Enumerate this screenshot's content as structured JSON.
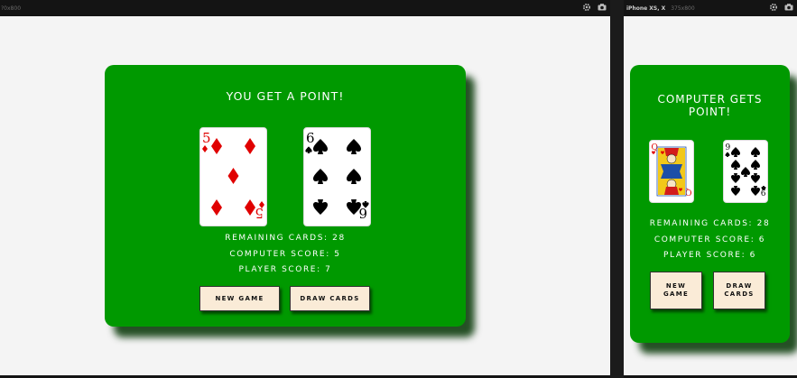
{
  "desktop": {
    "device_label": "?0x800",
    "heading": "YOU GET A POINT!",
    "cards": [
      {
        "rank": "5",
        "suit": "diamonds",
        "color": "#e00000"
      },
      {
        "rank": "6",
        "suit": "spades",
        "color": "#000000"
      }
    ],
    "remaining": "REMAINING CARDS: 28",
    "computer_score": "COMPUTER SCORE: 5",
    "player_score": "PLAYER SCORE: 7",
    "new_game_label": "NEW GAME",
    "draw_cards_label": "DRAW CARDS"
  },
  "mobile": {
    "device_label": "iPhone XS, X",
    "device_size": "375x800",
    "heading": "COMPUTER GETS POINT!",
    "cards": [
      {
        "rank": "Q",
        "suit": "hearts",
        "color": "#e00000"
      },
      {
        "rank": "9",
        "suit": "spades",
        "color": "#000000"
      }
    ],
    "remaining": "REMAINING CARDS: 28",
    "computer_score": "COMPUTER SCORE: 6",
    "player_score": "PLAYER SCORE: 6",
    "new_game_label": "NEW GAME",
    "draw_cards_label": "DRAW CARDS"
  },
  "theme": {
    "table_green": "#009900",
    "button_bg": "#faebd7",
    "page_bg": "#f4f4f4"
  },
  "icons": [
    "gear-icon",
    "camera-icon"
  ]
}
